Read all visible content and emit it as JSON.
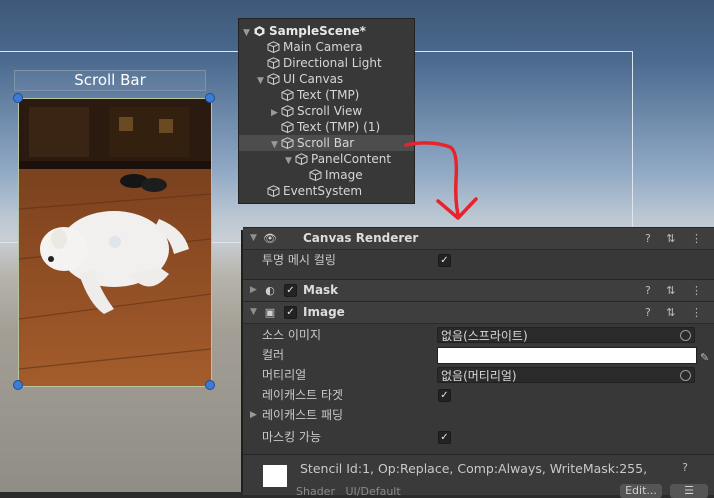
{
  "scene": {
    "scroll_bar_label": "Scroll Bar"
  },
  "hierarchy": {
    "items": [
      {
        "label": "SampleScene*",
        "depth": 0,
        "arrow": "▼",
        "root": true
      },
      {
        "label": "Main Camera",
        "depth": 1,
        "arrow": ""
      },
      {
        "label": "Directional Light",
        "depth": 1,
        "arrow": ""
      },
      {
        "label": "UI Canvas",
        "depth": 1,
        "arrow": "▼"
      },
      {
        "label": "Text (TMP)",
        "depth": 2,
        "arrow": ""
      },
      {
        "label": "Scroll View",
        "depth": 2,
        "arrow": "▶"
      },
      {
        "label": "Text (TMP) (1)",
        "depth": 2,
        "arrow": ""
      },
      {
        "label": "Scroll Bar",
        "depth": 2,
        "arrow": "▼",
        "selected": true
      },
      {
        "label": "PanelContent",
        "depth": 3,
        "arrow": "▼"
      },
      {
        "label": "Image",
        "depth": 4,
        "arrow": ""
      },
      {
        "label": "EventSystem",
        "depth": 1,
        "arrow": ""
      }
    ]
  },
  "inspector": {
    "canvas_renderer": {
      "title": "Canvas Renderer",
      "cull_label": "투명 메시 컬링",
      "cull_checked": true
    },
    "mask": {
      "title": "Mask",
      "enabled": true
    },
    "image": {
      "title": "Image",
      "enabled": true,
      "source_image_label": "소스 이미지",
      "source_image_value": "없음(스프라이트)",
      "color_label": "컬러",
      "color_value": "#ffffff",
      "material_label": "머티리얼",
      "material_value": "없음(머티리얼)",
      "raycast_target_label": "레이캐스트 타겟",
      "raycast_target_checked": true,
      "raycast_padding_label": "레이캐스트 패딩",
      "maskable_label": "마스킹 가능",
      "maskable_checked": true
    },
    "stencil": {
      "text": "Stencil Id:1, Op:Replace, Comp:Always, WriteMask:255,",
      "shader_label": "Shader",
      "shader_value": "UI/Default",
      "edit_label": "Edit..."
    },
    "header_icons": "? ⇅ ⋮"
  },
  "colors": {
    "accent_arrow": "#e8232a",
    "selection": "#4d4d4d"
  }
}
